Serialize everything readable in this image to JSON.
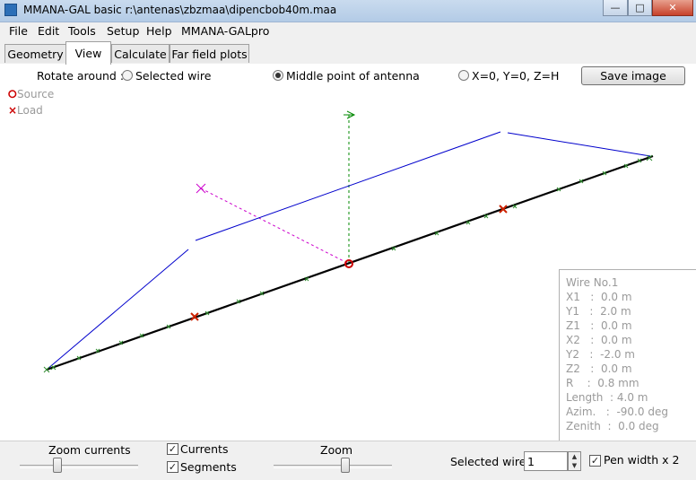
{
  "window": {
    "title": "MMANA-GAL basic r:\\antenas\\zbzmaa\\dipencbob40m.maa",
    "minimize_glyph": "—",
    "maximize_glyph": "□",
    "close_glyph": "✕"
  },
  "menu": [
    "File",
    "Edit",
    "Tools",
    "Setup",
    "Help",
    "MMANA-GALpro"
  ],
  "tabs": [
    "Geometry",
    "View",
    "Calculate",
    "Far field plots"
  ],
  "active_tab": "View",
  "rotate": {
    "label": "Rotate around :",
    "options": [
      "Selected wire",
      "Middle point of antenna",
      "X=0, Y=0, Z=H"
    ],
    "selected": "Middle point of antenna"
  },
  "save_image_label": "Save image",
  "legend": {
    "source": {
      "symbol": "⭘",
      "label": "Source",
      "color": "#cc0000"
    },
    "load": {
      "symbol": "×",
      "label": "Load",
      "color": "#cc0000"
    }
  },
  "wire_info": {
    "rows": [
      "Wire No.1",
      "X1   :  0.0 m",
      "Y1   :  2.0 m",
      "Z1   :  0.0 m",
      "X2   :  0.0 m",
      "Y2   :  -2.0 m",
      "Z2   :  0.0 m",
      "R    :  0.8 mm",
      "Length  : 4.0 m",
      "Azim.   :  -90.0 deg",
      "Zenith  :  0.0 deg"
    ]
  },
  "bottom": {
    "zoom_currents_label": "Zoom currents",
    "currents_label": "Currents",
    "currents_checked": true,
    "segments_label": "Segments",
    "segments_checked": true,
    "zoom_label": "Zoom",
    "selected_wire_label": "Selected wire",
    "selected_wire_value": "1",
    "pen_width_label": "Pen width x 2",
    "pen_width_checked": true
  },
  "colors": {
    "antenna_wire": "#000000",
    "current_curve": "#0000cc",
    "segment_marks": "#2e8b2e",
    "x_axis": "#cc00cc",
    "z_axis": "#008800",
    "source": "#cc0000",
    "load": "#cc2200"
  }
}
